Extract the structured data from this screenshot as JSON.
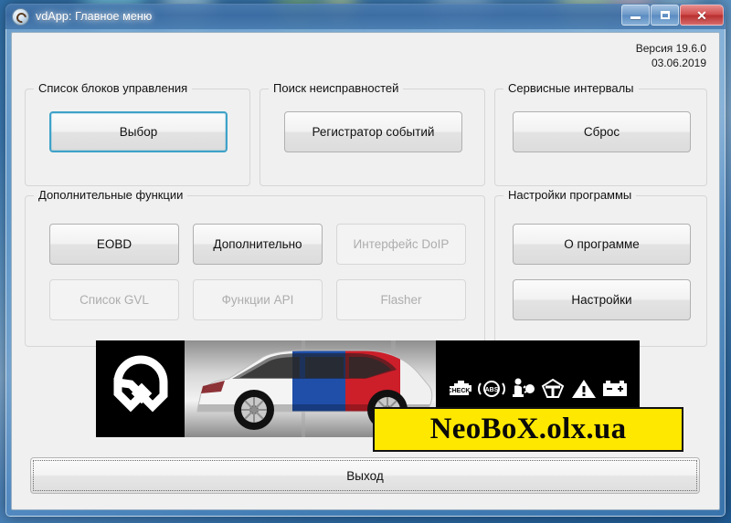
{
  "window": {
    "title": "vdApp:  Главное меню",
    "icon": "app-icon",
    "controls": {
      "minimize": "minimize-icon",
      "maximize": "maximize-icon",
      "close": "✕"
    }
  },
  "version": {
    "line1": "Версия 19.6.0",
    "line2": "03.06.2019"
  },
  "groups": [
    {
      "name": "control-units",
      "title": "Список блоков управления",
      "buttons": [
        {
          "label": "Выбор",
          "state": "focused"
        }
      ]
    },
    {
      "name": "fault-search",
      "title": "Поиск неисправностей",
      "buttons": [
        {
          "label": "Регистратор событий",
          "state": "enabled"
        }
      ]
    },
    {
      "name": "service-intervals",
      "title": "Сервисные интервалы",
      "buttons": [
        {
          "label": "Сброс",
          "state": "enabled"
        }
      ]
    },
    {
      "name": "additional-functions",
      "title": "Дополнительные функции",
      "buttons": [
        {
          "label": "EOBD",
          "state": "enabled"
        },
        {
          "label": "Дополнительно",
          "state": "enabled"
        },
        {
          "label": "Интерфейс DoIP",
          "state": "disabled"
        },
        {
          "label": "Список GVL",
          "state": "disabled"
        },
        {
          "label": "Функции API",
          "state": "disabled"
        },
        {
          "label": "Flasher",
          "state": "disabled"
        }
      ]
    },
    {
      "name": "program-settings",
      "title": "Настройки программы",
      "buttons": [
        {
          "label": "О программе",
          "state": "enabled"
        },
        {
          "label": "Настройки",
          "state": "enabled"
        }
      ]
    }
  ],
  "banner": {
    "logo": "brand-logo-icon",
    "car": "car-photo",
    "dashboard_icons": [
      "check-engine-icon",
      "abs-icon",
      "airbag-icon",
      "steering-icon",
      "warning-triangle-icon",
      "battery-icon"
    ]
  },
  "watermark": {
    "text": "NeoBoX.olx.ua",
    "background": "#ffe800",
    "color": "#0a0a0a"
  },
  "exit_button": {
    "label": "Выход"
  },
  "colors": {
    "client_bg": "#f0f0f0",
    "accent_focus": "#3ea2c8",
    "title_bar": "#2b5c96",
    "close_button": "#cf4c4c"
  }
}
